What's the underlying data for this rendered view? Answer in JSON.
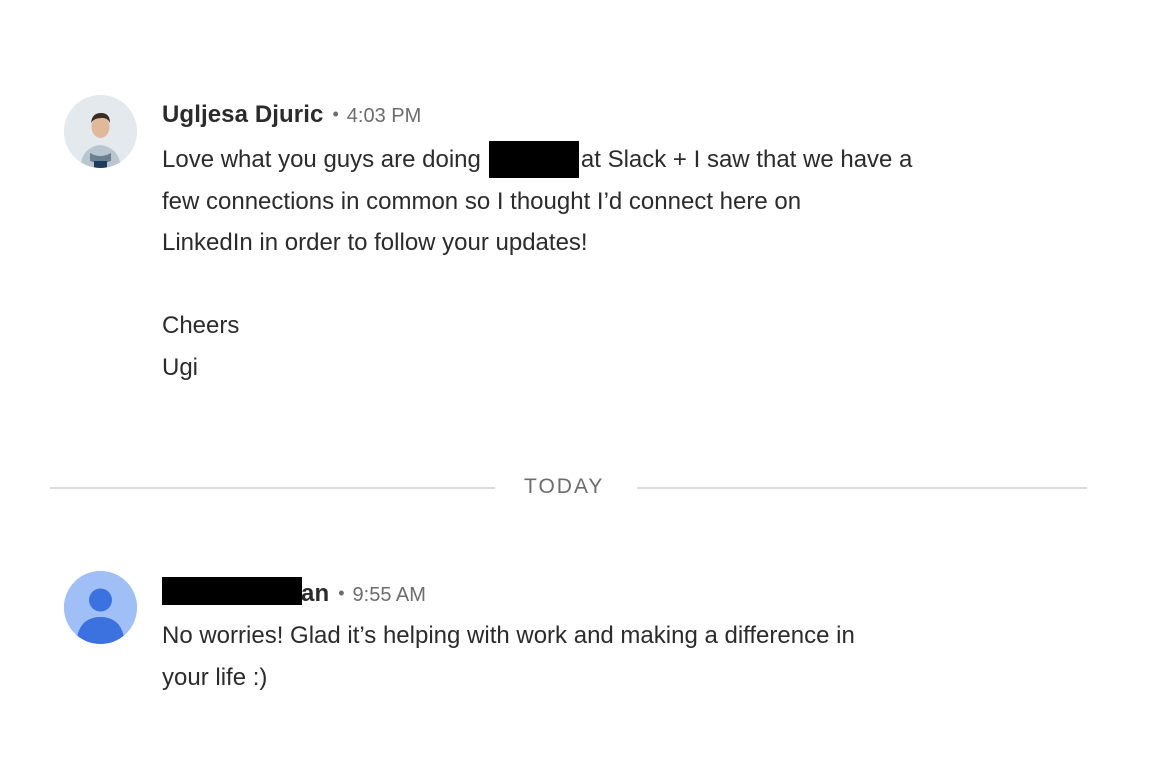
{
  "messages": [
    {
      "sender": "Ugljesa Djuric",
      "separator": "•",
      "time": "4:03 PM",
      "body": {
        "line1_before": "Love what you guys are doing",
        "line1_after": "at Slack + I saw that we have a",
        "line2": "few connections in common so I thought I’d connect here on",
        "line3": "LinkedIn in order to follow your updates!",
        "line5": "Cheers",
        "line6": "Ugi"
      }
    },
    {
      "sender_visible_suffix": "an",
      "separator": "•",
      "time": "9:55 AM",
      "body": {
        "line1": "No worries! Glad it’s helping with work and making a difference in",
        "line2": "your life :)"
      }
    }
  ],
  "divider": {
    "label": "TODAY"
  },
  "colors": {
    "text": "#2b2b2b",
    "muted": "#6c6c6c",
    "divider": "#dcdcdc",
    "generic_avatar_bg": "#a0bff7",
    "generic_avatar_fg": "#3b72e0"
  }
}
